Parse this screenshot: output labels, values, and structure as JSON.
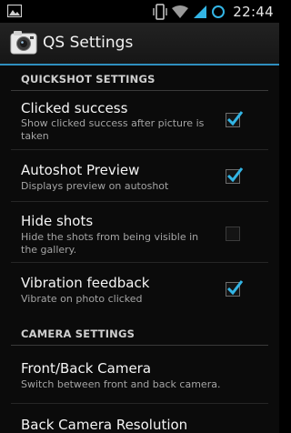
{
  "status_bar": {
    "time": "22:44",
    "icons": [
      "image-notification-icon",
      "vibrate-icon",
      "wifi-icon",
      "signal-icon",
      "sync-icon"
    ]
  },
  "action_bar": {
    "title": "QS Settings",
    "accent_color": "#2f8fbf"
  },
  "sections": [
    {
      "header": "QUICKSHOT SETTINGS",
      "items": [
        {
          "title": "Clicked success",
          "summary": "Show clicked success after picture is taken",
          "checked": true
        },
        {
          "title": "Autoshot Preview",
          "summary": "Displays preview on autoshot",
          "checked": true
        },
        {
          "title": "Hide shots",
          "summary": "Hide the shots from being visible in the gallery.",
          "checked": false
        },
        {
          "title": "Vibration feedback",
          "summary": "Vibrate on photo clicked",
          "checked": true
        }
      ]
    },
    {
      "header": "CAMERA SETTINGS",
      "items": [
        {
          "title": "Front/Back Camera",
          "summary": "Switch between front and back camera."
        },
        {
          "title": "Back Camera Resolution",
          "summary": ""
        }
      ]
    }
  ],
  "colors": {
    "checkmark": "#33b5e5",
    "background": "#0b0b0b"
  }
}
